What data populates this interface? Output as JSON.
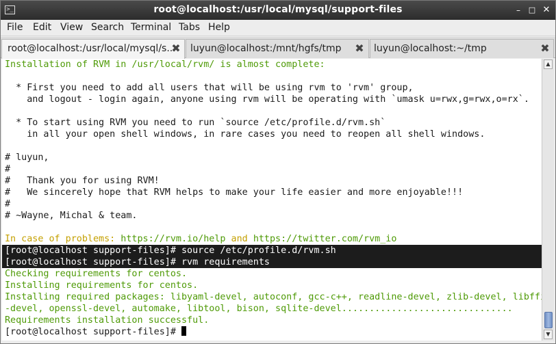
{
  "window": {
    "title": "root@localhost:/usr/local/mysql/support-files",
    "app_icon": "terminal-icon",
    "controls": {
      "minimize": "–",
      "maximize": "□",
      "close": "✕"
    }
  },
  "menu": {
    "items": [
      "File",
      "Edit",
      "View",
      "Search",
      "Terminal",
      "Tabs",
      "Help"
    ]
  },
  "tabs": [
    {
      "label": "root@localhost:/usr/local/mysql/s...",
      "active": true
    },
    {
      "label": "luyun@localhost:/mnt/hgfs/tmp",
      "active": false
    },
    {
      "label": "luyun@localhost:~/tmp",
      "active": false
    }
  ],
  "tab_close_glyph": "✖",
  "terminal": {
    "lines": [
      "Installation of RVM in /usr/local/rvm/ is almost complete:",
      "",
      "  * First you need to add all users that will be using rvm to 'rvm' group,",
      "    and logout - login again, anyone using rvm will be operating with `umask u=rwx,g=rwx,o=rx`.",
      "",
      "  * To start using RVM you need to run `source /etc/profile.d/rvm.sh`",
      "    in all your open shell windows, in rare cases you need to reopen all shell windows.",
      "",
      "# luyun,",
      "#",
      "#   Thank you for using RVM!",
      "#   We sincerely hope that RVM helps to make your life easier and more enjoyable!!!",
      "#",
      "# ~Wayne, Michal & team.",
      "",
      "In case of problems:",
      " https://rvm.io/help",
      " and ",
      "https://twitter.com/rvm_io",
      "[root@localhost support-files]# source /etc/profile.d/rvm.sh",
      "[root@localhost support-files]# rvm requirements",
      "Checking requirements for centos.",
      "Installing requirements for centos.",
      "Installing required packages: libyaml-devel, autoconf, gcc-c++, readline-devel, zlib-devel, libffi",
      "-devel, openssl-devel, automake, libtool, bison, sqlite-devel...............................",
      "Requirements installation successful.",
      "[root@localhost support-files]# "
    ]
  },
  "colors": {
    "terminal_green": "#4e9a06",
    "terminal_text": "#1a1a1a",
    "terminal_bg": "#ffffff",
    "selection_bg": "#1c1c1c",
    "scroll_thumb": "#7f9ccb"
  }
}
